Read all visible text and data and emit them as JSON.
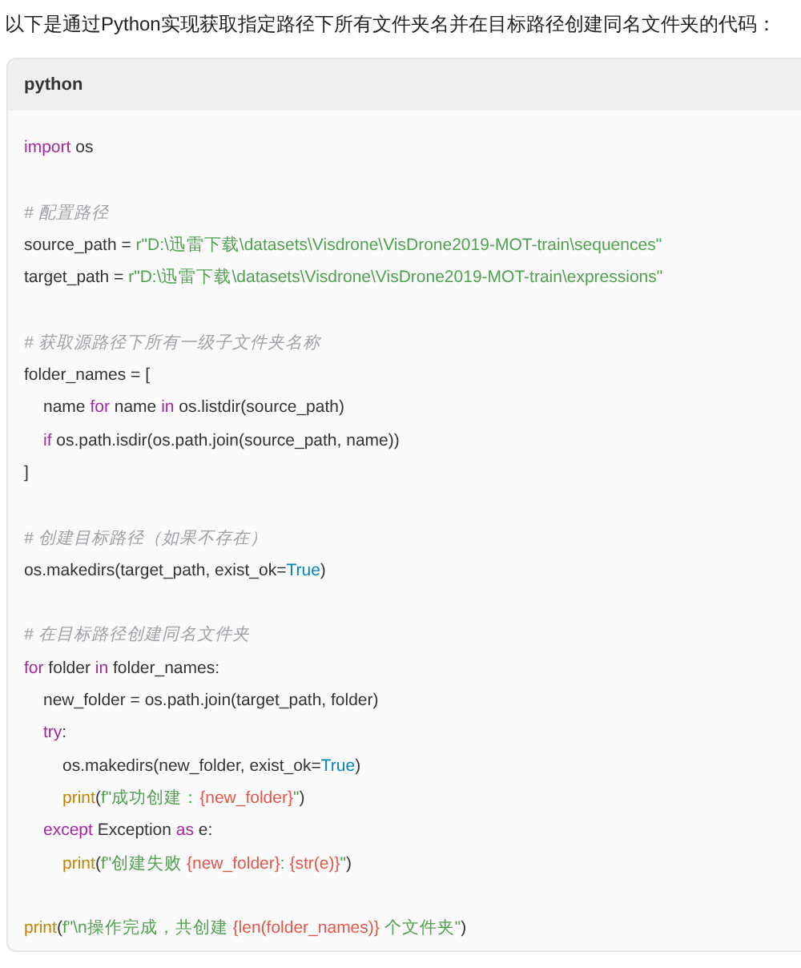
{
  "intro": "以下是通过Python实现获取指定路径下所有文件夹名并在目标路径创建同名文件夹的代码：",
  "code_block": {
    "language": "python",
    "lines": [
      {
        "kind": "code",
        "tokens": [
          {
            "kind": "keyword",
            "s": "import"
          },
          {
            "kind": "plain",
            "s": " os"
          }
        ]
      },
      {
        "kind": "blank"
      },
      {
        "kind": "code",
        "tokens": [
          {
            "kind": "comment",
            "s": "# 配置路径"
          }
        ]
      },
      {
        "kind": "code",
        "tokens": [
          {
            "kind": "plain",
            "s": "source_path = "
          },
          {
            "kind": "string",
            "s": "r\"D:\\迅雷下载\\datasets\\Visdrone\\VisDrone2019-MOT-train\\sequences\""
          }
        ]
      },
      {
        "kind": "code",
        "tokens": [
          {
            "kind": "plain",
            "s": "target_path = "
          },
          {
            "kind": "string",
            "s": "r\"D:\\迅雷下载\\datasets\\Visdrone\\VisDrone2019-MOT-train\\expressions\""
          }
        ]
      },
      {
        "kind": "blank"
      },
      {
        "kind": "code",
        "tokens": [
          {
            "kind": "comment",
            "s": "# 获取源路径下所有一级子文件夹名称"
          }
        ]
      },
      {
        "kind": "code",
        "tokens": [
          {
            "kind": "plain",
            "s": "folder_names = ["
          }
        ],
        "children": [
          {
            "kind": "code",
            "tokens": [
              {
                "kind": "plain",
                "s": "name "
              },
              {
                "kind": "keyword",
                "s": "for"
              },
              {
                "kind": "plain",
                "s": " name "
              },
              {
                "kind": "keyword",
                "s": "in"
              },
              {
                "kind": "plain",
                "s": " os.listdir(source_path)"
              }
            ]
          },
          {
            "kind": "code",
            "tokens": [
              {
                "kind": "keyword",
                "s": "if"
              },
              {
                "kind": "plain",
                "s": " os.path.isdir(os.path.join(source_path, name))"
              }
            ]
          }
        ]
      },
      {
        "kind": "code",
        "tokens": [
          {
            "kind": "plain",
            "s": "]"
          }
        ]
      },
      {
        "kind": "blank"
      },
      {
        "kind": "code",
        "tokens": [
          {
            "kind": "comment",
            "s": "# 创建目标路径（如果不存在）"
          }
        ]
      },
      {
        "kind": "code",
        "tokens": [
          {
            "kind": "plain",
            "s": "os.makedirs(target_path, exist_ok="
          },
          {
            "kind": "constant",
            "s": "True"
          },
          {
            "kind": "plain",
            "s": ")"
          }
        ]
      },
      {
        "kind": "blank"
      },
      {
        "kind": "code",
        "tokens": [
          {
            "kind": "comment",
            "s": "# 在目标路径创建同名文件夹"
          }
        ]
      },
      {
        "kind": "code",
        "tokens": [
          {
            "kind": "keyword",
            "s": "for"
          },
          {
            "kind": "plain",
            "s": " folder "
          },
          {
            "kind": "keyword",
            "s": "in"
          },
          {
            "kind": "plain",
            "s": " folder_names:"
          }
        ],
        "children": [
          {
            "kind": "code",
            "tokens": [
              {
                "kind": "plain",
                "s": "new_folder = os.path.join(target_path, folder)"
              }
            ]
          },
          {
            "kind": "code",
            "tokens": [
              {
                "kind": "keyword",
                "s": "try"
              },
              {
                "kind": "plain",
                "s": ":"
              }
            ],
            "children": [
              {
                "kind": "code",
                "tokens": [
                  {
                    "kind": "plain",
                    "s": "os.makedirs(new_folder, exist_ok="
                  },
                  {
                    "kind": "constant",
                    "s": "True"
                  },
                  {
                    "kind": "plain",
                    "s": ")"
                  }
                ]
              },
              {
                "kind": "code",
                "tokens": [
                  {
                    "kind": "builtin",
                    "s": "print"
                  },
                  {
                    "kind": "plain",
                    "s": "("
                  },
                  {
                    "kind": "string",
                    "s": "f\"成功创建："
                  },
                  {
                    "kind": "interp",
                    "s": "{new_folder}"
                  },
                  {
                    "kind": "string",
                    "s": "\""
                  },
                  {
                    "kind": "plain",
                    "s": ")"
                  }
                ]
              }
            ]
          },
          {
            "kind": "code",
            "tokens": [
              {
                "kind": "keyword",
                "s": "except"
              },
              {
                "kind": "plain",
                "s": " Exception "
              },
              {
                "kind": "keyword",
                "s": "as"
              },
              {
                "kind": "plain",
                "s": " e:"
              }
            ],
            "children": [
              {
                "kind": "code",
                "tokens": [
                  {
                    "kind": "builtin",
                    "s": "print"
                  },
                  {
                    "kind": "plain",
                    "s": "("
                  },
                  {
                    "kind": "string",
                    "s": "f\"创建失败 "
                  },
                  {
                    "kind": "interp",
                    "s": "{new_folder}"
                  },
                  {
                    "kind": "string",
                    "s": ": "
                  },
                  {
                    "kind": "interp",
                    "s": "{str(e)}"
                  },
                  {
                    "kind": "string",
                    "s": "\""
                  },
                  {
                    "kind": "plain",
                    "s": ")"
                  }
                ]
              }
            ]
          }
        ]
      },
      {
        "kind": "blank"
      },
      {
        "kind": "code",
        "tokens": [
          {
            "kind": "builtin",
            "s": "print"
          },
          {
            "kind": "plain",
            "s": "("
          },
          {
            "kind": "string",
            "s": "f\"\\n操作完成，共创建 "
          },
          {
            "kind": "interp",
            "s": "{len(folder_names)}"
          },
          {
            "kind": "string",
            "s": " 个文件夹\""
          },
          {
            "kind": "plain",
            "s": ")"
          }
        ]
      }
    ]
  }
}
